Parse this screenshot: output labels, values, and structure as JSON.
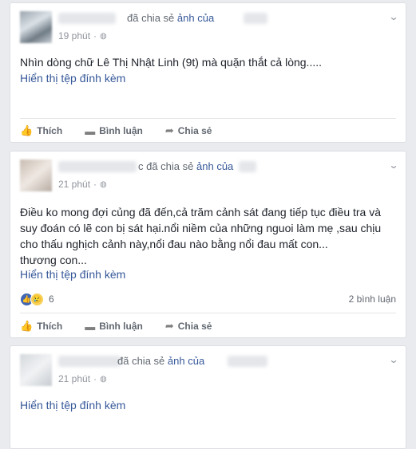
{
  "posts": [
    {
      "headline_action": "đã chia sẻ",
      "headline_link": "ảnh",
      "headline_tail": "của",
      "time": "19 phút",
      "body": "Nhìn dòng chữ Lê Thị Nhật Linh (9t) mà quặn thắt cả lòng.....",
      "attachment": "Hiển thị tệp đính kèm",
      "actions": {
        "like": "Thích",
        "comment": "Bình luận",
        "share": "Chia sẻ"
      }
    },
    {
      "headline_action": "c đã chia sẻ",
      "headline_link": "ảnh",
      "headline_tail": "của",
      "time": "21 phút",
      "body_lines": [
        "Điều ko mong đợi củng đã đến,cả trăm cảnh sát đang tiếp tục điều tra và",
        "suy đoán có lẽ con bị sát hại.nổi niềm của những nguoi làm mẹ ,sau chịu",
        "cho thấu nghịch cảnh này,nổi đau nào bằng nổi đau mất con...",
        "thương con..."
      ],
      "attachment": "Hiển thị tệp đính kèm",
      "reaction_count": "6",
      "comment_count": "2 bình luận",
      "actions": {
        "like": "Thích",
        "comment": "Bình luận",
        "share": "Chia sẻ"
      }
    },
    {
      "headline_action": "đã chia sẻ",
      "headline_link": "ảnh",
      "headline_tail": "của",
      "time": "21 phút",
      "attachment": "Hiển thị tệp đính kèm"
    }
  ],
  "icons": {
    "globe": "globe-icon",
    "chevron": "chevron-down-icon",
    "like": "thumbs-up-icon",
    "comment": "comment-icon",
    "share": "share-arrow-icon"
  },
  "colors": {
    "link": "#365899",
    "meta": "#90949c",
    "like_reaction": "#4267b2",
    "sad_reaction": "#f7d155"
  }
}
